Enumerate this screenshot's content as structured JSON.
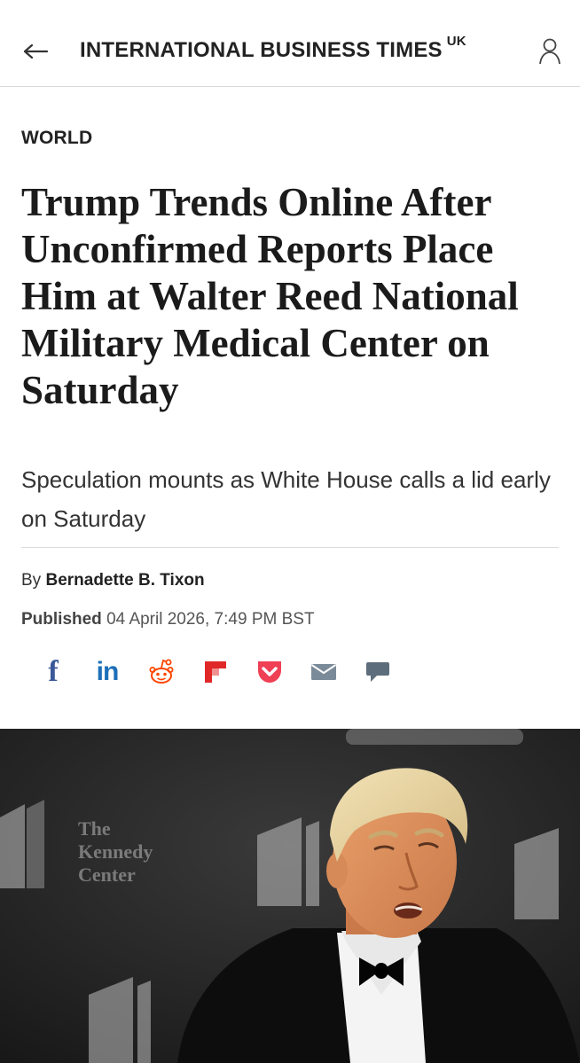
{
  "header": {
    "brand": "INTERNATIONAL BUSINESS TIMES",
    "edition": "UK",
    "back_icon": "arrow-left-icon",
    "account_icon": "user-icon"
  },
  "article": {
    "section": "WORLD",
    "headline": "Trump Trends Online After Unconfirmed Reports Place Him at Walter Reed National Military Medical Center on Saturday",
    "standfirst": "Speculation mounts as White House calls a lid early on Saturday",
    "byline_prefix": "By",
    "author": "Bernadette B. Tixon",
    "published_label": "Published",
    "published_date": "04 April 2026, 7:49 PM BST"
  },
  "share": {
    "facebook_glyph": "f",
    "linkedin_glyph": "in",
    "icons": [
      "facebook-icon",
      "linkedin-icon",
      "reddit-icon",
      "flipboard-icon",
      "pocket-icon",
      "email-icon",
      "comment-icon"
    ]
  },
  "image": {
    "backdrop_text_1": "The",
    "backdrop_text_2": "Kennedy",
    "backdrop_text_3": "Center"
  },
  "colors": {
    "facebook": "#3b5998",
    "linkedin": "#1d6fb8",
    "reddit": "#ff4500",
    "flipboard": "#e12828",
    "pocket": "#ef4056",
    "email": "#7a8a99",
    "comment": "#5d6d7c"
  }
}
